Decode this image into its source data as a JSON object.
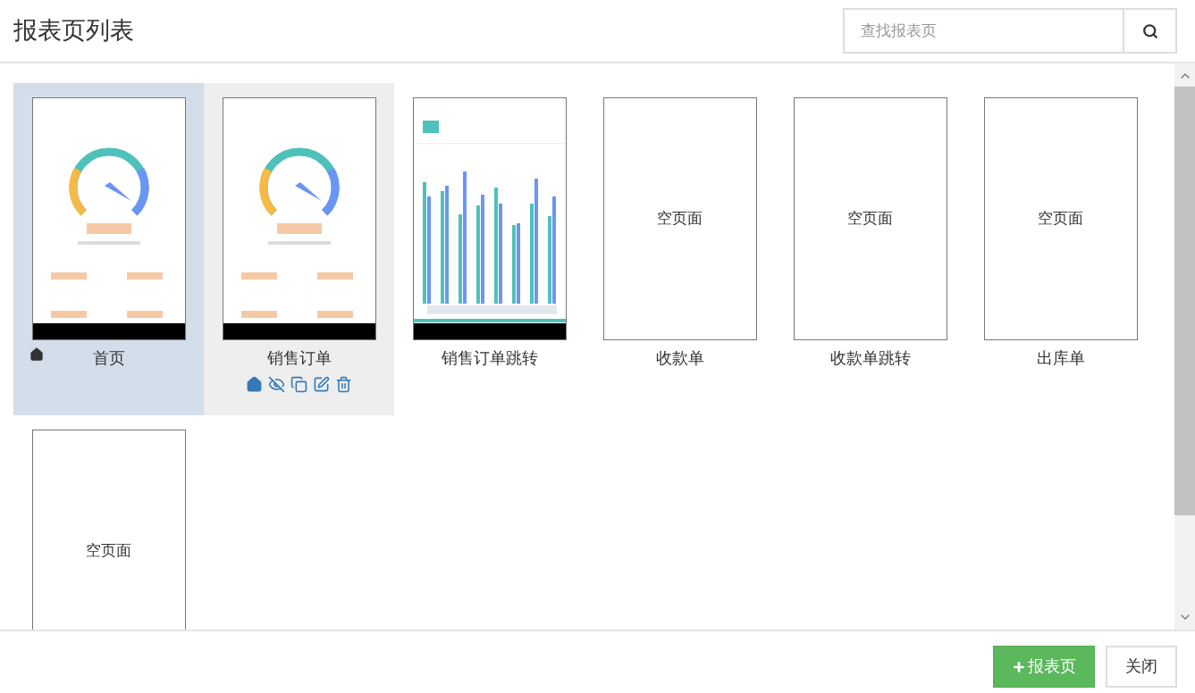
{
  "header": {
    "title": "报表页列表"
  },
  "search": {
    "placeholder": "查找报表页"
  },
  "pages": [
    {
      "name": "首页",
      "kind": "gauge",
      "selected": true,
      "hovered": false,
      "home": true
    },
    {
      "name": "销售订单",
      "kind": "gauge",
      "selected": false,
      "hovered": true,
      "home": false
    },
    {
      "name": "销售订单跳转",
      "kind": "bars",
      "selected": false,
      "hovered": false,
      "home": false
    },
    {
      "name": "收款单",
      "kind": "empty",
      "empty_label": "空页面",
      "selected": false,
      "hovered": false,
      "home": false
    },
    {
      "name": "收款单跳转",
      "kind": "empty",
      "empty_label": "空页面",
      "selected": false,
      "hovered": false,
      "home": false
    },
    {
      "name": "出库单",
      "kind": "empty",
      "empty_label": "空页面",
      "selected": false,
      "hovered": false,
      "home": false
    },
    {
      "kind": "empty",
      "empty_label": "空页面",
      "selected": false,
      "hovered": false,
      "home": false
    }
  ],
  "footer": {
    "buttons": [
      {
        "kind": "add",
        "label": "报表页"
      },
      {
        "kind": "close",
        "label": "关闭"
      }
    ]
  }
}
